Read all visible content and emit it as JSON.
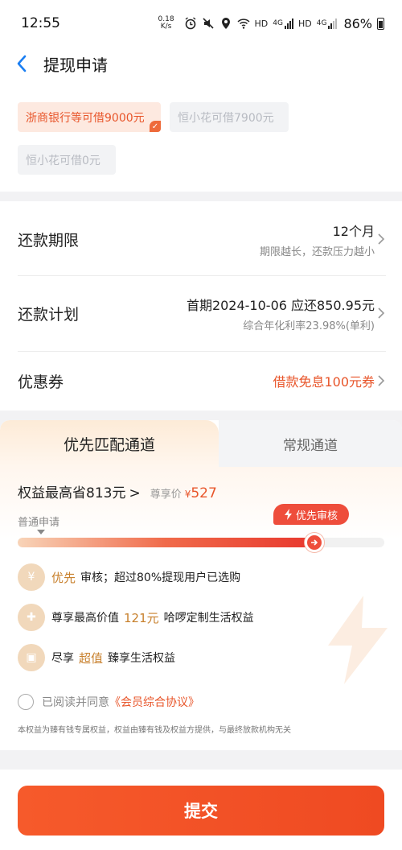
{
  "status_bar": {
    "time": "12:55",
    "net_speed_value": "0.18",
    "net_speed_unit": "K/s",
    "hd1": "HD",
    "hd2": "HD",
    "net1": "4G",
    "net2": "4G",
    "battery": "86%",
    "icons": [
      "alarm-icon",
      "mute-icon",
      "location-icon",
      "wifi-icon",
      "signal-icon",
      "battery-icon"
    ]
  },
  "header": {
    "title": "提现申请"
  },
  "quota": {
    "chips": [
      {
        "label": "浙商银行等可借9000元",
        "selected": true
      },
      {
        "label": "恒小花可借7900元",
        "selected": false
      },
      {
        "label": "恒小花可借0元",
        "selected": false
      }
    ]
  },
  "form": {
    "term": {
      "label": "还款期限",
      "value": "12个月",
      "hint": "期限越长，还款压力越小"
    },
    "plan": {
      "label": "还款计划",
      "value": "首期2024-10-06 应还850.95元",
      "hint": "综合年化利率23.98%(单利)"
    },
    "coupon": {
      "label": "优惠券",
      "value": "借款免息100元券"
    }
  },
  "membership": {
    "tabs": [
      {
        "label": "优先匹配通道",
        "active": true
      },
      {
        "label": "常规通道",
        "active": false
      }
    ],
    "save_text": "权益最高省813元",
    "arrow": ">",
    "vip_price_label": "尊享价",
    "currency": "¥",
    "vip_price": "527",
    "normal_label": "普通申请",
    "priority_label": "优先审核",
    "progress": 0.81,
    "benefits": [
      {
        "pre": "",
        "highlight": "优先",
        "post": "审核；超过80%提现用户已选购",
        "icon": "money-bag-icon"
      },
      {
        "pre": "尊享最高价值",
        "highlight": "121元",
        "post": "哈啰定制生活权益",
        "icon": "gift-icon"
      },
      {
        "pre": "尽享",
        "highlight": "超值",
        "post": "臻享生活权益",
        "icon": "ticket-icon"
      }
    ],
    "agree_prefix": "已阅读并同意",
    "agree_link": "《会员综合协议》",
    "disclaimer": "本权益为臻有钱专属权益，权益由臻有钱及权益方提供，与最终放款机构无关"
  },
  "footer": {
    "submit_label": "提交"
  },
  "colors": {
    "accent": "#e8552a",
    "submit": "#f65a2b",
    "gold": "#c8812e"
  }
}
